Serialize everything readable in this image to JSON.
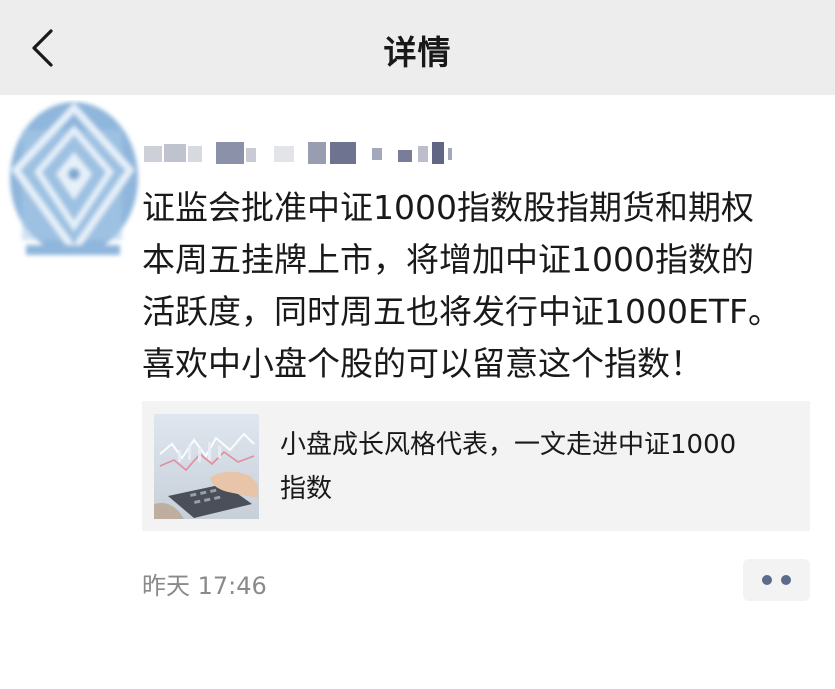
{
  "header": {
    "title": "详情",
    "back_icon": "chevron-left-icon"
  },
  "post": {
    "lines": [
      "证监会批准中证1000指数股指期货和期权",
      "本周五挂牌上市，将增加中证1000指数的",
      "活跃度，同时周五也将发行中证1000ETF。",
      "喜欢中小盘个股的可以留意这个指数！"
    ],
    "link_card": {
      "title_line1": "小盘成长风格代表，一文走进中证1000",
      "title_line2": "指数",
      "thumbnail_icon": "calculator-chart-thumbnail"
    },
    "timestamp": "昨天 17:46",
    "more_icon": "more-dots-icon"
  },
  "colors": {
    "header_bg": "#ededed",
    "card_bg": "#f3f3f3",
    "text": "#191919",
    "meta": "#8a8a8a",
    "dots": "#5a6b8c"
  }
}
